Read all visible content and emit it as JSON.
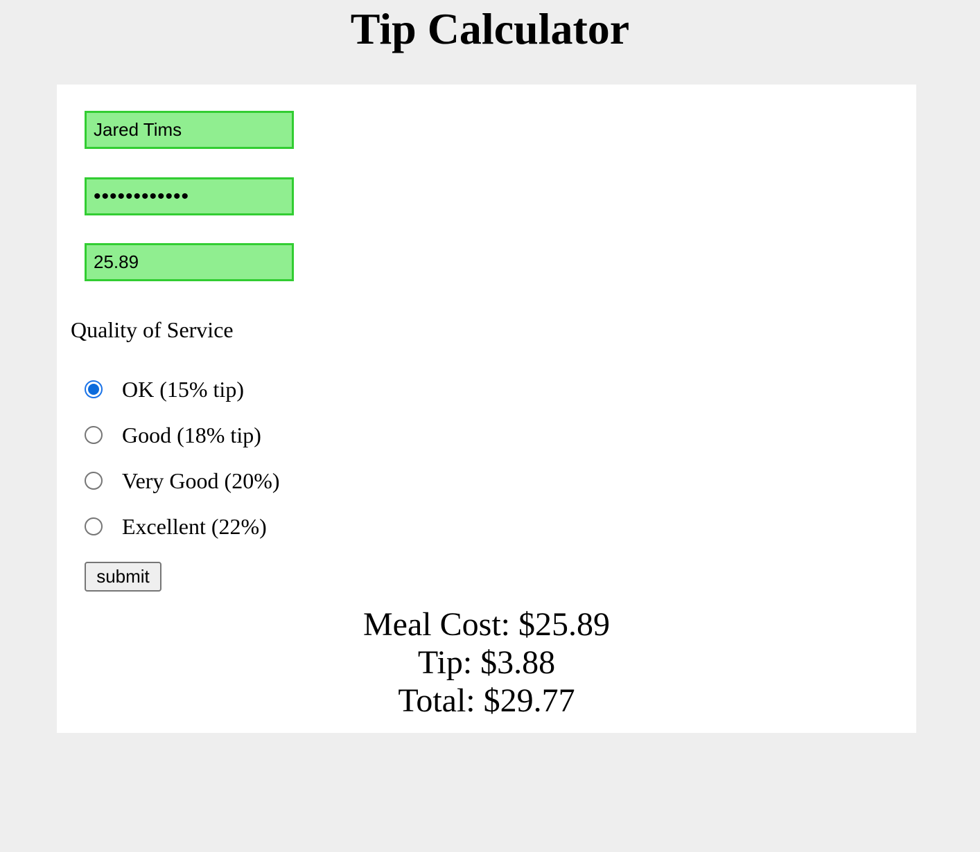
{
  "page": {
    "title": "Tip Calculator"
  },
  "form": {
    "name_value": "Jared Tims",
    "password_value": "••••••••••••",
    "meal_cost_value": "25.89",
    "service_label": "Quality of Service",
    "options": [
      {
        "label": "OK (15% tip)",
        "checked": true
      },
      {
        "label": "Good (18% tip)",
        "checked": false
      },
      {
        "label": "Very Good (20%)",
        "checked": false
      },
      {
        "label": "Excellent (22%)",
        "checked": false
      }
    ],
    "submit_label": "submit"
  },
  "results": {
    "meal_cost": "Meal Cost: $25.89",
    "tip": "Tip: $3.88",
    "total": "Total: $29.77"
  },
  "colors": {
    "field_fill": "#90ee90",
    "field_border": "#32cd32",
    "radio_checked": "#0b6bdc",
    "page_background": "#eeeeee",
    "card_background": "#ffffff"
  }
}
